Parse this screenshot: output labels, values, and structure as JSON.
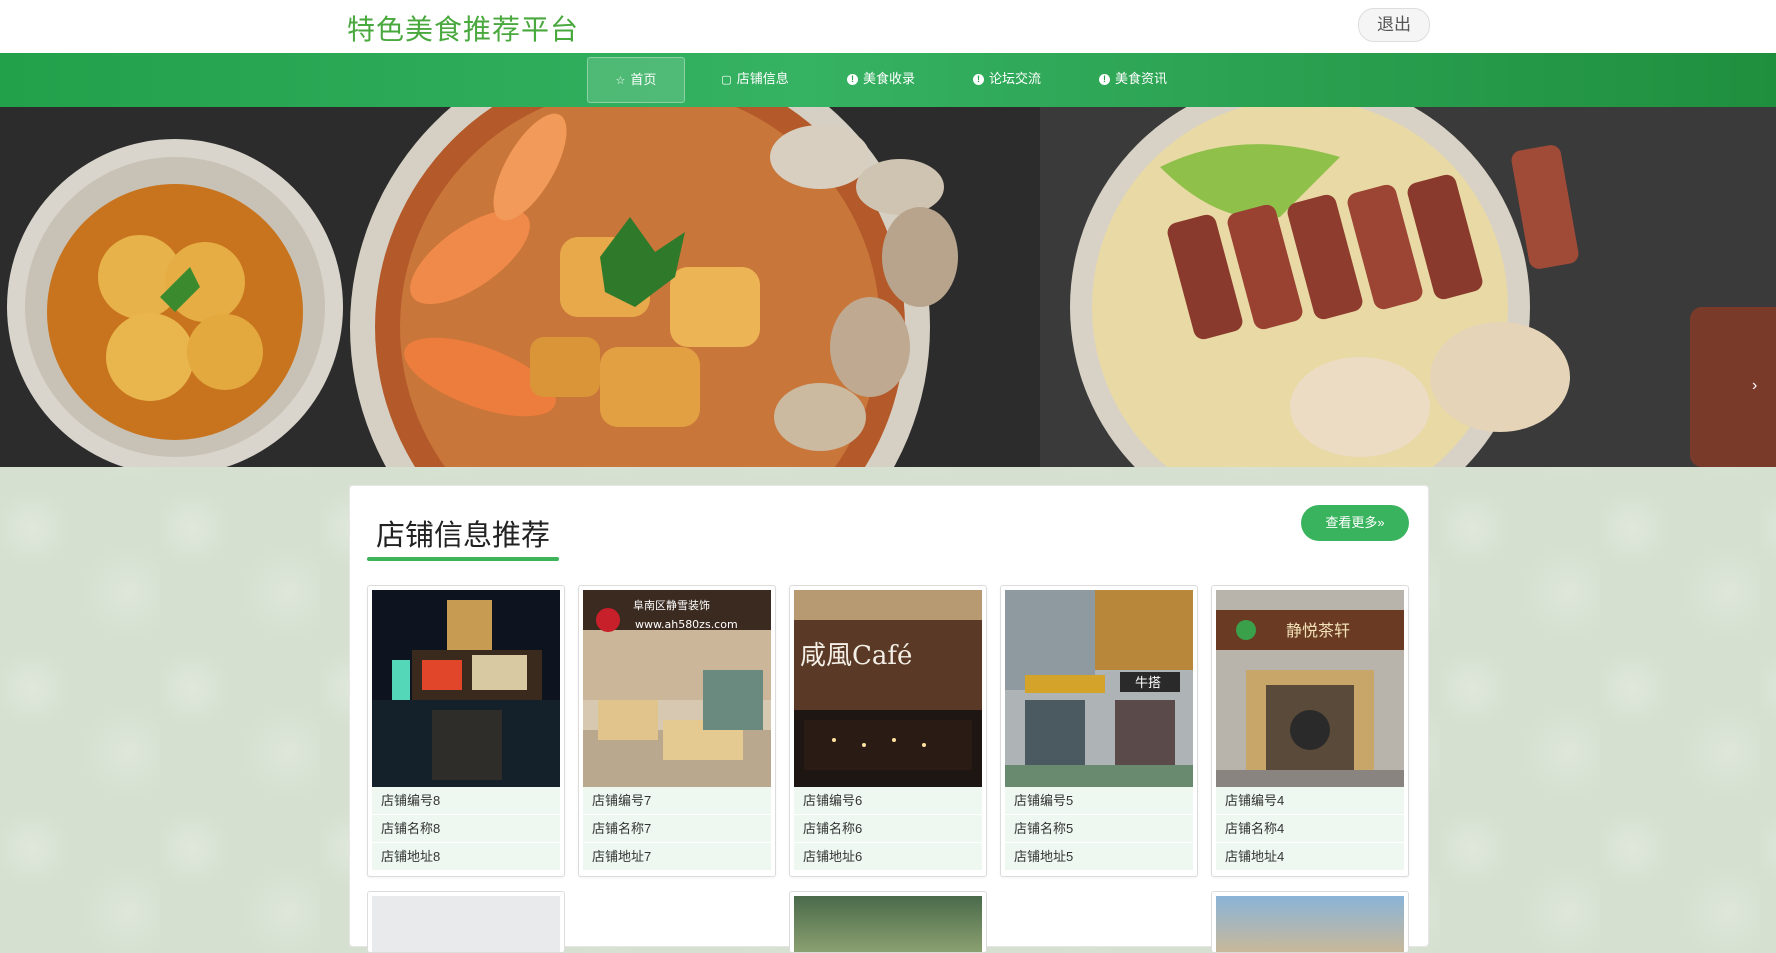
{
  "header": {
    "title": "特色美食推荐平台",
    "logout_label": "退出"
  },
  "nav": {
    "items": [
      {
        "label": "首页",
        "icon": "star-icon",
        "active": true
      },
      {
        "label": "店铺信息",
        "icon": "bag-icon",
        "active": false
      },
      {
        "label": "美食收录",
        "icon": "info-icon",
        "active": false
      },
      {
        "label": "论坛交流",
        "icon": "info-icon",
        "active": false
      },
      {
        "label": "美食资讯",
        "icon": "info-icon",
        "active": false
      }
    ]
  },
  "banner": {
    "next_icon": "chevron-right-icon"
  },
  "section": {
    "title": "店铺信息推荐",
    "more_label": "查看更多»",
    "shops": [
      {
        "no": "店铺编号8",
        "name": "店铺名称8",
        "address": "店铺地址8"
      },
      {
        "no": "店铺编号7",
        "name": "店铺名称7",
        "address": "店铺地址7"
      },
      {
        "no": "店铺编号6",
        "name": "店铺名称6",
        "address": "店铺地址6"
      },
      {
        "no": "店铺编号5",
        "name": "店铺名称5",
        "address": "店铺地址5"
      },
      {
        "no": "店铺编号4",
        "name": "店铺名称4",
        "address": "店铺地址4"
      }
    ],
    "shop_image_texts": {
      "shop7_sign": "阜南区静雪装饰",
      "shop7_url": "www.ah580zs.com",
      "shop6_sign": "咸風Café",
      "shop5_sign": "牛搭",
      "shop4_sign": "静悦茶轩"
    }
  },
  "colors": {
    "brand_green": "#3ab35e",
    "title_green": "#4aa93e"
  }
}
